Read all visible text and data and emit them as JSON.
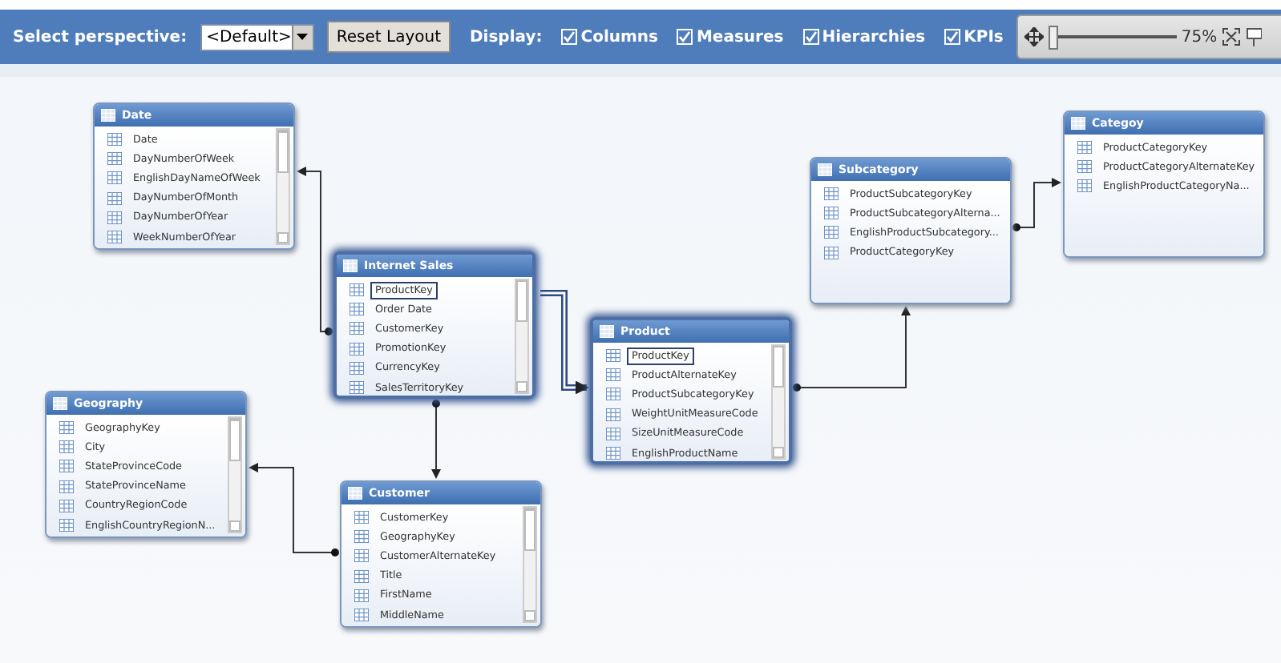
{
  "toolbar": {
    "perspective_label": "Select perspective:",
    "perspective": {
      "value": "<Default>"
    },
    "reset_button": "Reset Layout",
    "display_label": "Display:",
    "display_options": [
      {
        "label": "Columns",
        "checked": true
      },
      {
        "label": "Measures",
        "checked": true
      },
      {
        "label": "Hierarchies",
        "checked": true
      },
      {
        "label": "KPIs",
        "checked": true
      }
    ],
    "zoom": {
      "level": 0.04,
      "reading": "75%"
    }
  },
  "tables": [
    {
      "name": "Date",
      "selected": false,
      "scrollbar": true,
      "columns": [
        {
          "name": "Date",
          "selected": false
        },
        {
          "name": "DayNumberOfWeek",
          "selected": false
        },
        {
          "name": "EnglishDayNameOfWeek",
          "selected": false
        },
        {
          "name": "DayNumberOfMonth",
          "selected": false
        },
        {
          "name": "DayNumberOfYear",
          "selected": false
        },
        {
          "name": "WeekNumberOfYear",
          "selected": false
        }
      ]
    },
    {
      "name": "Internet Sales",
      "selected": true,
      "scrollbar": true,
      "columns": [
        {
          "name": "ProductKey",
          "selected": true
        },
        {
          "name": "Order Date",
          "selected": false
        },
        {
          "name": "CustomerKey",
          "selected": false
        },
        {
          "name": "PromotionKey",
          "selected": false
        },
        {
          "name": "CurrencyKey",
          "selected": false
        },
        {
          "name": "SalesTerritoryKey",
          "selected": false
        }
      ]
    },
    {
      "name": "Product",
      "selected": true,
      "scrollbar": true,
      "columns": [
        {
          "name": "ProductKey",
          "selected": true
        },
        {
          "name": "ProductAlternateKey",
          "selected": false
        },
        {
          "name": "ProductSubcategoryKey",
          "selected": false
        },
        {
          "name": "WeightUnitMeasureCode",
          "selected": false
        },
        {
          "name": "SizeUnitMeasureCode",
          "selected": false
        },
        {
          "name": "EnglishProductName",
          "selected": false
        }
      ]
    },
    {
      "name": "Subcategory",
      "selected": false,
      "scrollbar": false,
      "columns": [
        {
          "name": "ProductSubcategoryKey",
          "selected": false
        },
        {
          "name": "ProductSubcategoryAlterna...",
          "selected": false
        },
        {
          "name": "EnglishProductSubcategory...",
          "selected": false
        },
        {
          "name": "ProductCategoryKey",
          "selected": false
        }
      ]
    },
    {
      "name": "Categoy",
      "selected": false,
      "scrollbar": false,
      "columns": [
        {
          "name": "ProductCategoryKey",
          "selected": false
        },
        {
          "name": "ProductCategoryAlternateKey",
          "selected": false
        },
        {
          "name": "EnglishProductCategoryNa...",
          "selected": false
        }
      ]
    },
    {
      "name": "Geography",
      "selected": false,
      "scrollbar": true,
      "columns": [
        {
          "name": "GeographyKey",
          "selected": false
        },
        {
          "name": "City",
          "selected": false
        },
        {
          "name": "StateProvinceCode",
          "selected": false
        },
        {
          "name": "StateProvinceName",
          "selected": false
        },
        {
          "name": "CountryRegionCode",
          "selected": false
        },
        {
          "name": "EnglishCountryRegionN...",
          "selected": false
        }
      ]
    },
    {
      "name": "Customer",
      "selected": false,
      "scrollbar": true,
      "columns": [
        {
          "name": "CustomerKey",
          "selected": false
        },
        {
          "name": "GeographyKey",
          "selected": false
        },
        {
          "name": "CustomerAlternateKey",
          "selected": false
        },
        {
          "name": "Title",
          "selected": false
        },
        {
          "name": "FirstName",
          "selected": false
        },
        {
          "name": "MiddleName",
          "selected": false
        }
      ]
    }
  ],
  "relationships": [
    {
      "kind": "normal"
    },
    {
      "kind": "highlighted"
    },
    {
      "kind": "normal"
    },
    {
      "kind": "normal"
    },
    {
      "kind": "normal"
    },
    {
      "kind": "normal"
    }
  ]
}
